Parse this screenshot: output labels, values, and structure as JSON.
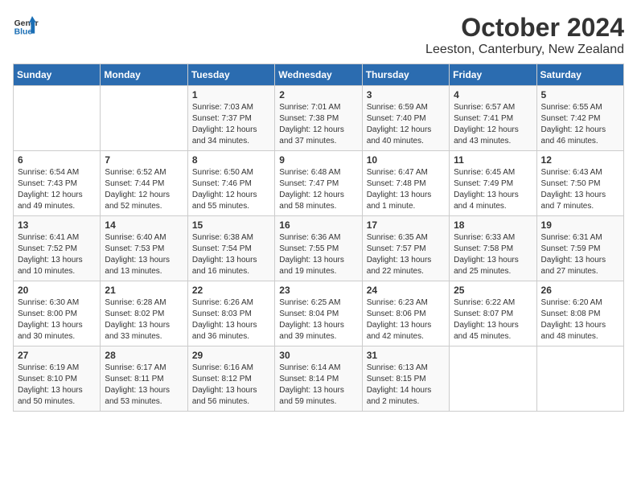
{
  "header": {
    "logo_line1": "General",
    "logo_line2": "Blue",
    "month": "October 2024",
    "location": "Leeston, Canterbury, New Zealand"
  },
  "weekdays": [
    "Sunday",
    "Monday",
    "Tuesday",
    "Wednesday",
    "Thursday",
    "Friday",
    "Saturday"
  ],
  "weeks": [
    [
      {
        "day": "",
        "info": ""
      },
      {
        "day": "",
        "info": ""
      },
      {
        "day": "1",
        "info": "Sunrise: 7:03 AM\nSunset: 7:37 PM\nDaylight: 12 hours\nand 34 minutes."
      },
      {
        "day": "2",
        "info": "Sunrise: 7:01 AM\nSunset: 7:38 PM\nDaylight: 12 hours\nand 37 minutes."
      },
      {
        "day": "3",
        "info": "Sunrise: 6:59 AM\nSunset: 7:40 PM\nDaylight: 12 hours\nand 40 minutes."
      },
      {
        "day": "4",
        "info": "Sunrise: 6:57 AM\nSunset: 7:41 PM\nDaylight: 12 hours\nand 43 minutes."
      },
      {
        "day": "5",
        "info": "Sunrise: 6:55 AM\nSunset: 7:42 PM\nDaylight: 12 hours\nand 46 minutes."
      }
    ],
    [
      {
        "day": "6",
        "info": "Sunrise: 6:54 AM\nSunset: 7:43 PM\nDaylight: 12 hours\nand 49 minutes."
      },
      {
        "day": "7",
        "info": "Sunrise: 6:52 AM\nSunset: 7:44 PM\nDaylight: 12 hours\nand 52 minutes."
      },
      {
        "day": "8",
        "info": "Sunrise: 6:50 AM\nSunset: 7:46 PM\nDaylight: 12 hours\nand 55 minutes."
      },
      {
        "day": "9",
        "info": "Sunrise: 6:48 AM\nSunset: 7:47 PM\nDaylight: 12 hours\nand 58 minutes."
      },
      {
        "day": "10",
        "info": "Sunrise: 6:47 AM\nSunset: 7:48 PM\nDaylight: 13 hours\nand 1 minute."
      },
      {
        "day": "11",
        "info": "Sunrise: 6:45 AM\nSunset: 7:49 PM\nDaylight: 13 hours\nand 4 minutes."
      },
      {
        "day": "12",
        "info": "Sunrise: 6:43 AM\nSunset: 7:50 PM\nDaylight: 13 hours\nand 7 minutes."
      }
    ],
    [
      {
        "day": "13",
        "info": "Sunrise: 6:41 AM\nSunset: 7:52 PM\nDaylight: 13 hours\nand 10 minutes."
      },
      {
        "day": "14",
        "info": "Sunrise: 6:40 AM\nSunset: 7:53 PM\nDaylight: 13 hours\nand 13 minutes."
      },
      {
        "day": "15",
        "info": "Sunrise: 6:38 AM\nSunset: 7:54 PM\nDaylight: 13 hours\nand 16 minutes."
      },
      {
        "day": "16",
        "info": "Sunrise: 6:36 AM\nSunset: 7:55 PM\nDaylight: 13 hours\nand 19 minutes."
      },
      {
        "day": "17",
        "info": "Sunrise: 6:35 AM\nSunset: 7:57 PM\nDaylight: 13 hours\nand 22 minutes."
      },
      {
        "day": "18",
        "info": "Sunrise: 6:33 AM\nSunset: 7:58 PM\nDaylight: 13 hours\nand 25 minutes."
      },
      {
        "day": "19",
        "info": "Sunrise: 6:31 AM\nSunset: 7:59 PM\nDaylight: 13 hours\nand 27 minutes."
      }
    ],
    [
      {
        "day": "20",
        "info": "Sunrise: 6:30 AM\nSunset: 8:00 PM\nDaylight: 13 hours\nand 30 minutes."
      },
      {
        "day": "21",
        "info": "Sunrise: 6:28 AM\nSunset: 8:02 PM\nDaylight: 13 hours\nand 33 minutes."
      },
      {
        "day": "22",
        "info": "Sunrise: 6:26 AM\nSunset: 8:03 PM\nDaylight: 13 hours\nand 36 minutes."
      },
      {
        "day": "23",
        "info": "Sunrise: 6:25 AM\nSunset: 8:04 PM\nDaylight: 13 hours\nand 39 minutes."
      },
      {
        "day": "24",
        "info": "Sunrise: 6:23 AM\nSunset: 8:06 PM\nDaylight: 13 hours\nand 42 minutes."
      },
      {
        "day": "25",
        "info": "Sunrise: 6:22 AM\nSunset: 8:07 PM\nDaylight: 13 hours\nand 45 minutes."
      },
      {
        "day": "26",
        "info": "Sunrise: 6:20 AM\nSunset: 8:08 PM\nDaylight: 13 hours\nand 48 minutes."
      }
    ],
    [
      {
        "day": "27",
        "info": "Sunrise: 6:19 AM\nSunset: 8:10 PM\nDaylight: 13 hours\nand 50 minutes."
      },
      {
        "day": "28",
        "info": "Sunrise: 6:17 AM\nSunset: 8:11 PM\nDaylight: 13 hours\nand 53 minutes."
      },
      {
        "day": "29",
        "info": "Sunrise: 6:16 AM\nSunset: 8:12 PM\nDaylight: 13 hours\nand 56 minutes."
      },
      {
        "day": "30",
        "info": "Sunrise: 6:14 AM\nSunset: 8:14 PM\nDaylight: 13 hours\nand 59 minutes."
      },
      {
        "day": "31",
        "info": "Sunrise: 6:13 AM\nSunset: 8:15 PM\nDaylight: 14 hours\nand 2 minutes."
      },
      {
        "day": "",
        "info": ""
      },
      {
        "day": "",
        "info": ""
      }
    ]
  ]
}
